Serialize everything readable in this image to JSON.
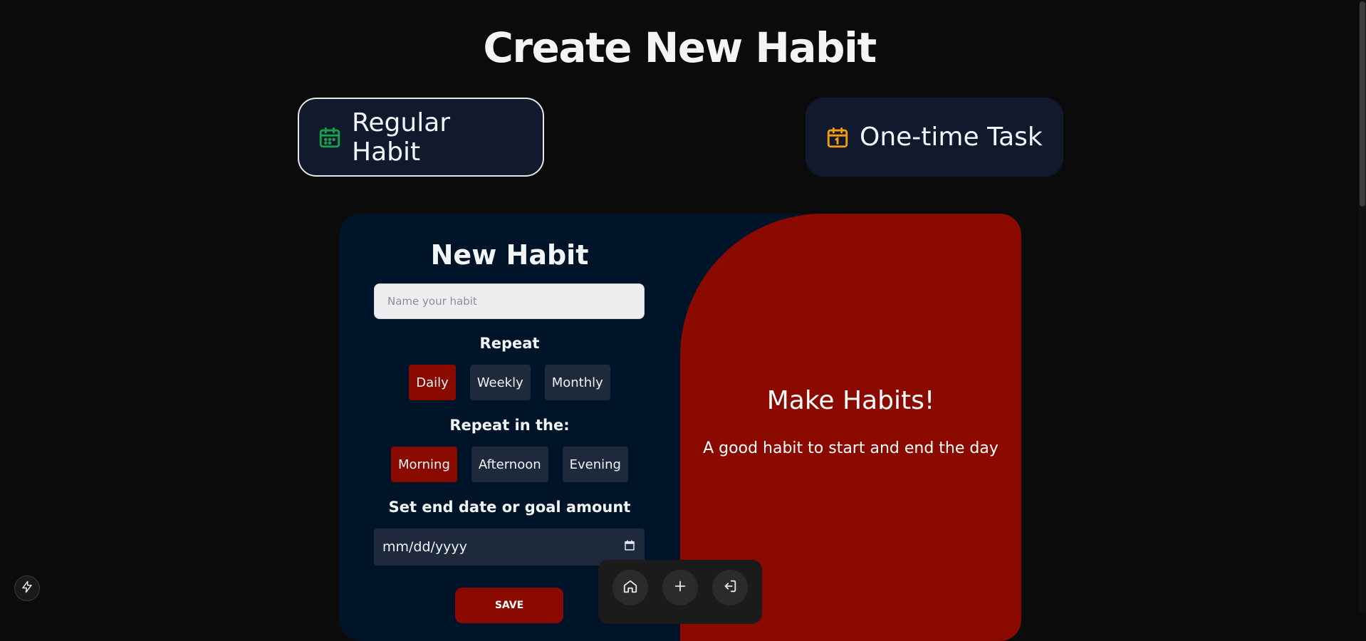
{
  "page": {
    "title": "Create New Habit"
  },
  "type_tabs": {
    "regular": {
      "label": "Regular Habit",
      "icon": "calendar-grid-icon",
      "color": "#15a34a",
      "active": true
    },
    "onetime": {
      "label": "One-time Task",
      "icon": "calendar-one-icon",
      "color": "#f59e0b",
      "active": false
    }
  },
  "form": {
    "title": "New Habit",
    "name_placeholder": "Name your habit",
    "repeat_label": "Repeat",
    "repeat_options": [
      "Daily",
      "Weekly",
      "Monthly"
    ],
    "repeat_selected": "Daily",
    "time_label": "Repeat in the:",
    "time_options": [
      "Morning",
      "Afternoon",
      "Evening"
    ],
    "time_selected": "Morning",
    "end_label": "Set end date or goal amount",
    "date_placeholder": "mm/dd/yyyy",
    "save_label": "SAVE"
  },
  "promo": {
    "title": "Make Habits!",
    "subtitle": "A good habit to start and end the day"
  },
  "bottom_nav": {
    "items": [
      {
        "icon": "home-icon"
      },
      {
        "icon": "plus-icon"
      },
      {
        "icon": "logout-icon"
      }
    ]
  },
  "colors": {
    "background": "#0b0b0b",
    "card": "#001429",
    "accent_red": "#8b0a00",
    "pill": "#1e293b",
    "tab": "#111a2c"
  }
}
